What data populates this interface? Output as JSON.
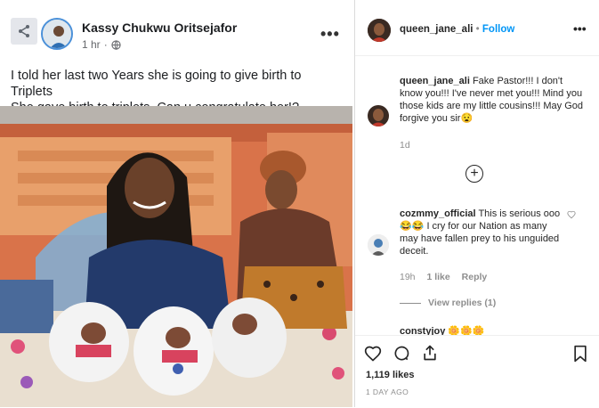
{
  "facebook": {
    "author": "Kassy Chukwu Oritsejafor",
    "time": "1 hr",
    "separator": "·",
    "more": "•••",
    "post_line1": "I told her last two Years she is going to give birth to Triplets",
    "post_line2": "She gave birth to triplets. Can u congratulate her!?"
  },
  "instagram": {
    "username": "queen_jane_ali",
    "dot": "•",
    "follow": "Follow",
    "more": "•••",
    "comment1": {
      "user": "queen_jane_ali",
      "text": "Fake Pastor!!! I don't know you!!! I've never met you!!! Mind you those kids are my little cousins!!! May God forgive you sir😧",
      "age": "1d"
    },
    "load_more": "+",
    "comment2": {
      "user": "cozmmy_official",
      "text": "This is serious ooo 😂😂 I cry for our Nation as many may have fallen prey to his unguided deceit.",
      "age": "19h",
      "likes": "1 like",
      "reply": "Reply",
      "view_replies": "View replies (1)"
    },
    "comment3_user": "constyjoy 🌼🌼🌼",
    "likes": "1,119 likes",
    "date": "1 DAY AGO"
  }
}
